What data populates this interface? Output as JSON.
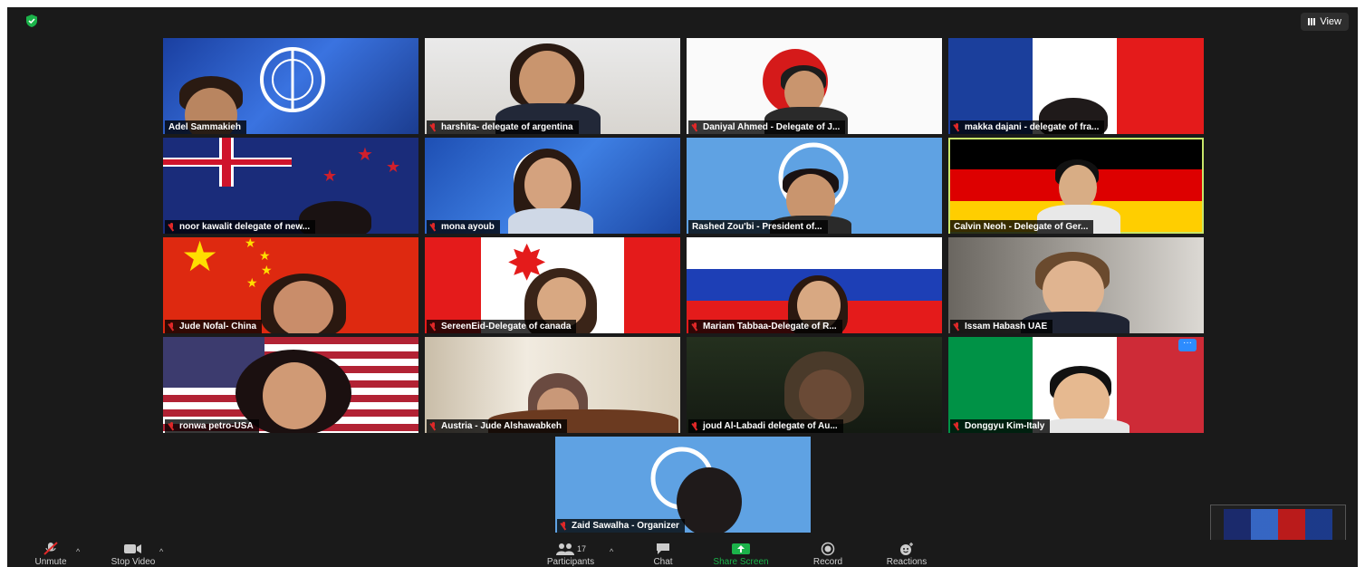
{
  "header": {
    "view_label": "View"
  },
  "participants": [
    {
      "name": "Adel Sammakieh",
      "muted": false
    },
    {
      "name": "harshita- delegate of argentina",
      "muted": true
    },
    {
      "name": "Daniyal Ahmed - Delegate of J...",
      "muted": true
    },
    {
      "name": "makka dajani - delegate of fra...",
      "muted": true
    },
    {
      "name": "noor kawalit delegate of new...",
      "muted": true
    },
    {
      "name": "mona ayoub",
      "muted": true
    },
    {
      "name": "Rashed Zou'bi - President of...",
      "muted": false
    },
    {
      "name": "Calvin Neoh - Delegate of Ger...",
      "muted": false
    },
    {
      "name": "Jude Nofal- China",
      "muted": true
    },
    {
      "name": "SereenEid-Delegate of canada",
      "muted": true
    },
    {
      "name": "Mariam Tabbaa-Delegate of R...",
      "muted": true
    },
    {
      "name": "Issam Habash UAE",
      "muted": true
    },
    {
      "name": "ronwa petro-USA",
      "muted": true
    },
    {
      "name": "Austria - Jude Alshawabkeh",
      "muted": true
    },
    {
      "name": "joud Al-Labadi delegate of Au...",
      "muted": true
    },
    {
      "name": "Donggyu Kim-Italy",
      "muted": true
    },
    {
      "name": "Zaid Sawalha - Organizer",
      "muted": true
    }
  ],
  "toolbar": {
    "unmute": "Unmute",
    "stop_video": "Stop Video",
    "participants": "Participants",
    "participants_count": "17",
    "chat": "Chat",
    "share_screen": "Share Screen",
    "record": "Record",
    "reactions": "Reactions"
  },
  "colors": {
    "share_green": "#1bb34a",
    "active_speaker": "#c8e66a",
    "accent_blue": "#2d8cff"
  }
}
